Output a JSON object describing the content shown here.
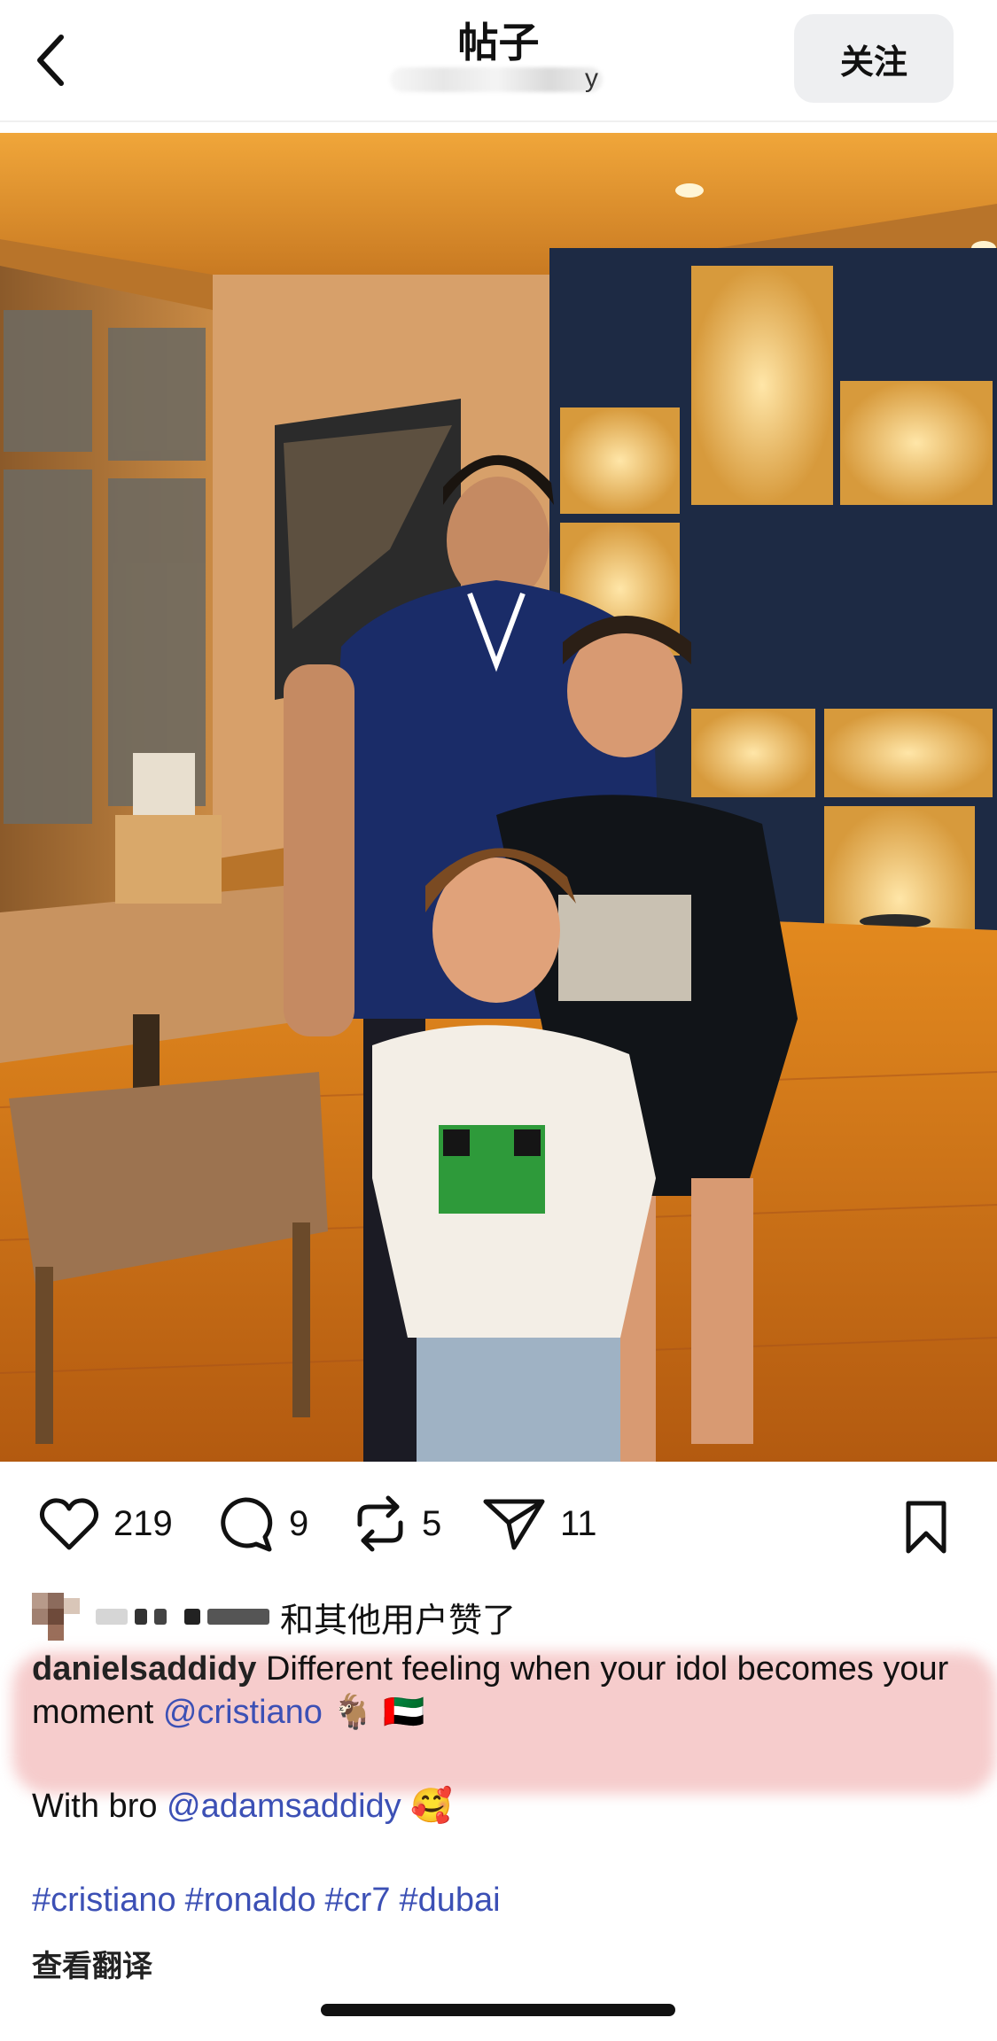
{
  "header": {
    "title": "帖子",
    "subtitle_visible_char": "y",
    "follow_label": "关注"
  },
  "post": {
    "actions": {
      "likes": "219",
      "comments": "9",
      "reposts": "5",
      "shares": "11"
    },
    "liked_by_text": "和其他用户赞了",
    "caption": {
      "username": "danielsaddidy",
      "text1": "Different feeling when your idol becomes your moment",
      "mention1": "@cristiano",
      "emoji1": "🐐",
      "flag": "🇦🇪",
      "line2_prefix": "With bro",
      "mention2": "@adamsaddidy",
      "emoji2": "🥰",
      "hashtags": [
        "#cristiano",
        "#ronaldo",
        "#cr7",
        "#dubai"
      ]
    },
    "translate_label": "查看翻译"
  },
  "colors": {
    "link": "#3c50b5",
    "highlight": "#e87878",
    "follow_bg": "#eeeff1"
  },
  "icons": [
    "back-arrow-icon",
    "heart-icon",
    "comment-icon",
    "repost-icon",
    "share-icon",
    "bookmark-icon"
  ]
}
